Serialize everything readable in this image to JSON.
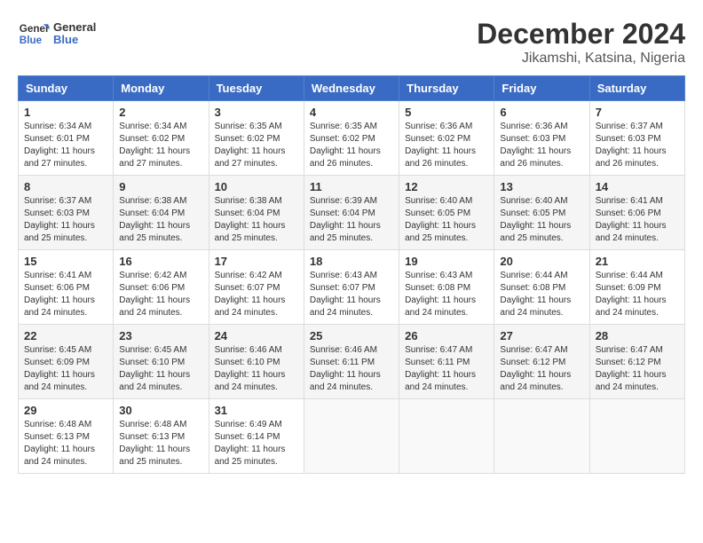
{
  "logo": {
    "line1": "General",
    "line2": "Blue"
  },
  "title": "December 2024",
  "subtitle": "Jikamshi, Katsina, Nigeria",
  "headers": [
    "Sunday",
    "Monday",
    "Tuesday",
    "Wednesday",
    "Thursday",
    "Friday",
    "Saturday"
  ],
  "weeks": [
    [
      {
        "day": "1",
        "info": "Sunrise: 6:34 AM\nSunset: 6:01 PM\nDaylight: 11 hours\nand 27 minutes."
      },
      {
        "day": "2",
        "info": "Sunrise: 6:34 AM\nSunset: 6:02 PM\nDaylight: 11 hours\nand 27 minutes."
      },
      {
        "day": "3",
        "info": "Sunrise: 6:35 AM\nSunset: 6:02 PM\nDaylight: 11 hours\nand 27 minutes."
      },
      {
        "day": "4",
        "info": "Sunrise: 6:35 AM\nSunset: 6:02 PM\nDaylight: 11 hours\nand 26 minutes."
      },
      {
        "day": "5",
        "info": "Sunrise: 6:36 AM\nSunset: 6:02 PM\nDaylight: 11 hours\nand 26 minutes."
      },
      {
        "day": "6",
        "info": "Sunrise: 6:36 AM\nSunset: 6:03 PM\nDaylight: 11 hours\nand 26 minutes."
      },
      {
        "day": "7",
        "info": "Sunrise: 6:37 AM\nSunset: 6:03 PM\nDaylight: 11 hours\nand 26 minutes."
      }
    ],
    [
      {
        "day": "8",
        "info": "Sunrise: 6:37 AM\nSunset: 6:03 PM\nDaylight: 11 hours\nand 25 minutes."
      },
      {
        "day": "9",
        "info": "Sunrise: 6:38 AM\nSunset: 6:04 PM\nDaylight: 11 hours\nand 25 minutes."
      },
      {
        "day": "10",
        "info": "Sunrise: 6:38 AM\nSunset: 6:04 PM\nDaylight: 11 hours\nand 25 minutes."
      },
      {
        "day": "11",
        "info": "Sunrise: 6:39 AM\nSunset: 6:04 PM\nDaylight: 11 hours\nand 25 minutes."
      },
      {
        "day": "12",
        "info": "Sunrise: 6:40 AM\nSunset: 6:05 PM\nDaylight: 11 hours\nand 25 minutes."
      },
      {
        "day": "13",
        "info": "Sunrise: 6:40 AM\nSunset: 6:05 PM\nDaylight: 11 hours\nand 25 minutes."
      },
      {
        "day": "14",
        "info": "Sunrise: 6:41 AM\nSunset: 6:06 PM\nDaylight: 11 hours\nand 24 minutes."
      }
    ],
    [
      {
        "day": "15",
        "info": "Sunrise: 6:41 AM\nSunset: 6:06 PM\nDaylight: 11 hours\nand 24 minutes."
      },
      {
        "day": "16",
        "info": "Sunrise: 6:42 AM\nSunset: 6:06 PM\nDaylight: 11 hours\nand 24 minutes."
      },
      {
        "day": "17",
        "info": "Sunrise: 6:42 AM\nSunset: 6:07 PM\nDaylight: 11 hours\nand 24 minutes."
      },
      {
        "day": "18",
        "info": "Sunrise: 6:43 AM\nSunset: 6:07 PM\nDaylight: 11 hours\nand 24 minutes."
      },
      {
        "day": "19",
        "info": "Sunrise: 6:43 AM\nSunset: 6:08 PM\nDaylight: 11 hours\nand 24 minutes."
      },
      {
        "day": "20",
        "info": "Sunrise: 6:44 AM\nSunset: 6:08 PM\nDaylight: 11 hours\nand 24 minutes."
      },
      {
        "day": "21",
        "info": "Sunrise: 6:44 AM\nSunset: 6:09 PM\nDaylight: 11 hours\nand 24 minutes."
      }
    ],
    [
      {
        "day": "22",
        "info": "Sunrise: 6:45 AM\nSunset: 6:09 PM\nDaylight: 11 hours\nand 24 minutes."
      },
      {
        "day": "23",
        "info": "Sunrise: 6:45 AM\nSunset: 6:10 PM\nDaylight: 11 hours\nand 24 minutes."
      },
      {
        "day": "24",
        "info": "Sunrise: 6:46 AM\nSunset: 6:10 PM\nDaylight: 11 hours\nand 24 minutes."
      },
      {
        "day": "25",
        "info": "Sunrise: 6:46 AM\nSunset: 6:11 PM\nDaylight: 11 hours\nand 24 minutes."
      },
      {
        "day": "26",
        "info": "Sunrise: 6:47 AM\nSunset: 6:11 PM\nDaylight: 11 hours\nand 24 minutes."
      },
      {
        "day": "27",
        "info": "Sunrise: 6:47 AM\nSunset: 6:12 PM\nDaylight: 11 hours\nand 24 minutes."
      },
      {
        "day": "28",
        "info": "Sunrise: 6:47 AM\nSunset: 6:12 PM\nDaylight: 11 hours\nand 24 minutes."
      }
    ],
    [
      {
        "day": "29",
        "info": "Sunrise: 6:48 AM\nSunset: 6:13 PM\nDaylight: 11 hours\nand 24 minutes."
      },
      {
        "day": "30",
        "info": "Sunrise: 6:48 AM\nSunset: 6:13 PM\nDaylight: 11 hours\nand 25 minutes."
      },
      {
        "day": "31",
        "info": "Sunrise: 6:49 AM\nSunset: 6:14 PM\nDaylight: 11 hours\nand 25 minutes."
      },
      {
        "day": "",
        "info": ""
      },
      {
        "day": "",
        "info": ""
      },
      {
        "day": "",
        "info": ""
      },
      {
        "day": "",
        "info": ""
      }
    ]
  ]
}
